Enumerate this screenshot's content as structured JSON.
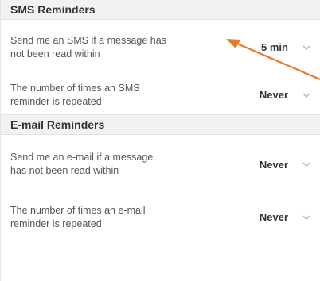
{
  "sms_section": {
    "title": "SMS Reminders",
    "settings": [
      {
        "label": "Send me an SMS if a message has not been read within",
        "value": "5 min",
        "icon": "chevron-down-icon"
      },
      {
        "label": "The number of times an SMS reminder is repeated",
        "value": "Never",
        "icon": "chevron-down-icon"
      }
    ]
  },
  "email_section": {
    "title": "E-mail Reminders",
    "settings": [
      {
        "label": "Send me an e-mail if a message has not been read within",
        "value": "Never",
        "icon": "chevron-down-icon"
      },
      {
        "label": "The number of times an e-mail reminder is repeated",
        "value": "Never",
        "icon": "chevron-down-icon"
      }
    ]
  },
  "annotation": {
    "arrow_color": "#e8782a",
    "icon": "pointer-arrow-icon"
  },
  "colors": {
    "header_bg": "#f2f2f2",
    "header_text": "#333333",
    "label_text": "#555555"
  }
}
